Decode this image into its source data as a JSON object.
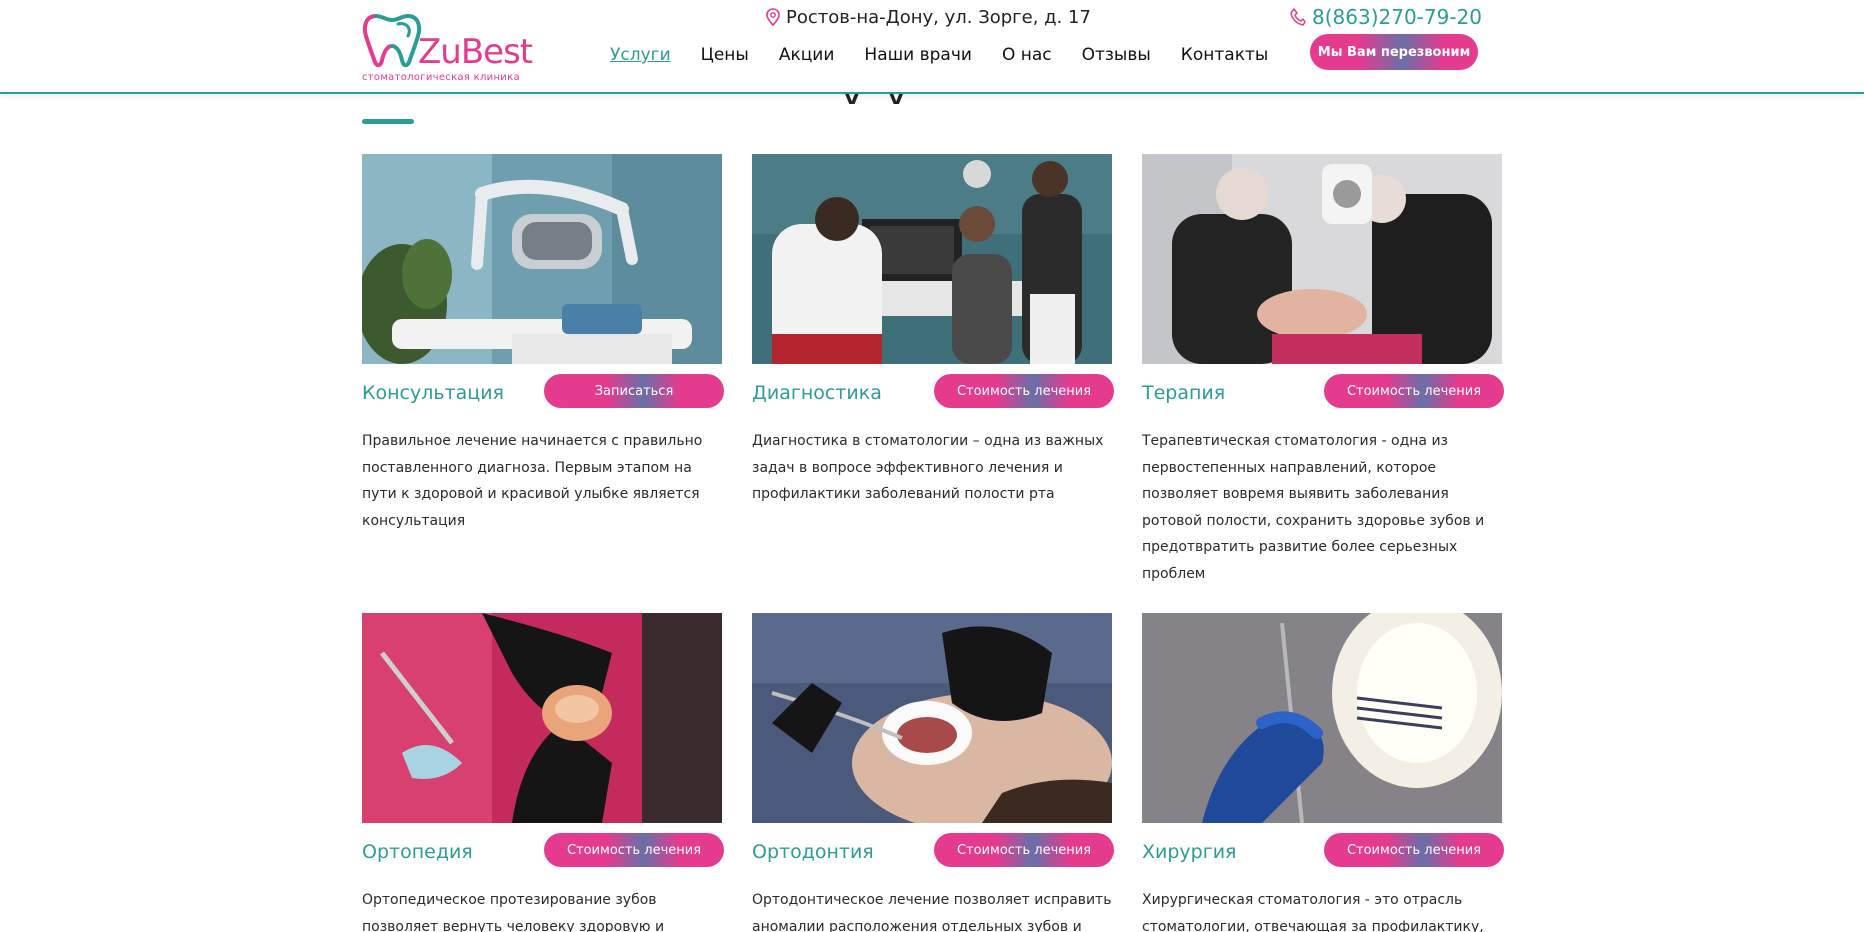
{
  "header": {
    "logo": {
      "name": "ZuBest",
      "subtitle": "стоматологическая клиника"
    },
    "address": "Ростов-на-Дону, ул. Зорге, д. 17",
    "phone": "8(863)270-79-20",
    "nav": [
      {
        "label": "Услуги",
        "active": true
      },
      {
        "label": "Цены"
      },
      {
        "label": "Акции"
      },
      {
        "label": "Наши врачи"
      },
      {
        "label": "О нас"
      },
      {
        "label": "Отзывы"
      },
      {
        "label": "Контакты"
      }
    ],
    "callback_label": "Мы Вам перезвоним"
  },
  "section": {
    "heading_fragment": "у у"
  },
  "services": [
    {
      "title": "Консультация",
      "button": "Записаться",
      "description": "Правильное  лечение начинается с правильно поставленного диагноза. Первым этапом на пути к здоровой и красивой улыбке является консультация"
    },
    {
      "title": "Диагностика",
      "button": "Стоимость лечения",
      "description": "Диагностика в стоматологии – одна из важных задач в вопросе эффективного лечения и профилактики заболеваний полости рта"
    },
    {
      "title": "Терапия",
      "button": "Стоимость лечения",
      "description": "Терапевтическая стоматология - одна из первостепенных направлений, которое позволяет вовремя выявить заболевания ротовой полости, сохранить здоровье зубов и предотвратить развитие более серьезных проблем"
    },
    {
      "title": "Ортопедия",
      "button": "Стоимость лечения",
      "description": "Ортопедическое протезирование зубов позволяет вернуть человеку здоровую и"
    },
    {
      "title": "Ортодонтия",
      "button": "Стоимость лечения",
      "description": "Ортодонтическое лечение позволяет исправить аномалии расположения отдельных зубов и"
    },
    {
      "title": "Хирургия",
      "button": "Стоимость лечения",
      "description": "Хирургическая стоматология - это отрасль стоматологии, отвечающая за профилактику,"
    }
  ],
  "colors": {
    "brand_pink": "#e43b8f",
    "brand_teal": "#2a9d96"
  }
}
